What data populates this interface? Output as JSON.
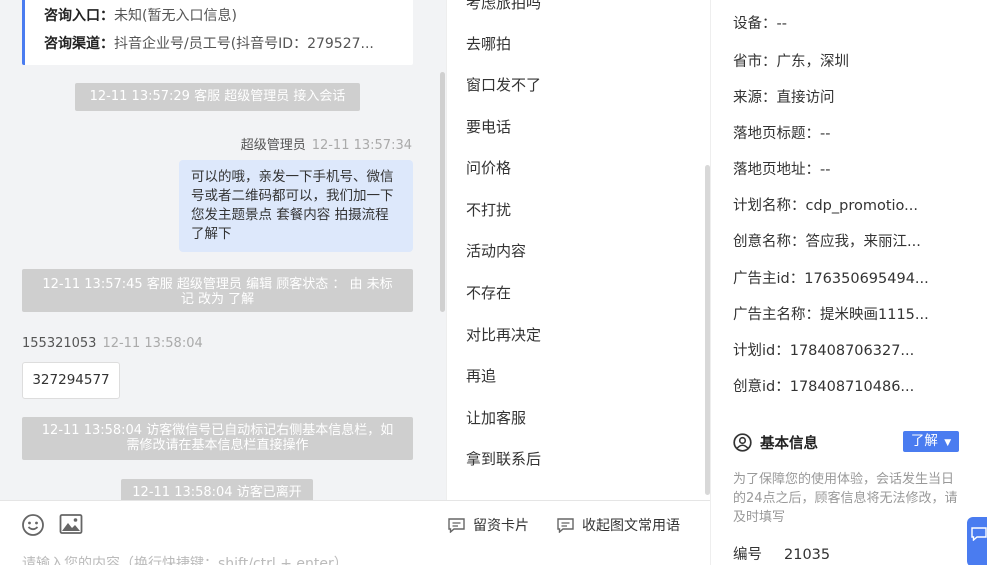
{
  "chat": {
    "info_card": {
      "entry_label": "咨询入口：",
      "entry_value": "未知(暂无入口信息)",
      "channel_label": "咨询渠道：",
      "channel_value": "抖音企业号/员工号(抖音号ID：279527..."
    },
    "sys_1": "12-11 13:57:29 客服 超级管理员 接入会话",
    "msg_1": {
      "sender": "超级管理员",
      "time": "12-11 13:57:34",
      "text": "可以的哦，亲发一下手机号、微信号或者二维码都可以，我们加一下您发主题景点 套餐内容 拍摄流程了解下"
    },
    "sys_2": "12-11 13:57:45 客服 超级管理员 编辑 顾客状态 ： 由 未标记 改为 了解",
    "msg_2": {
      "sender": "155321053",
      "time": "12-11 13:58:04",
      "text": "327294577"
    },
    "sys_3": "12-11 13:58:04 访客微信号已自动标记右侧基本信息栏，如需修改请在基本信息栏直接操作",
    "sys_4": "12-11 13:58:04 访客已离开"
  },
  "input": {
    "card_label": "留资卡片",
    "phrases_label": "收起图文常用语",
    "placeholder": "请输入您的内容（换行快捷键：shift/ctrl + enter）"
  },
  "quick_replies": {
    "top_partial": "考虑旅拍吗",
    "items": [
      "去哪拍",
      "窗口发不了",
      "要电话",
      "问价格",
      "不打扰",
      "活动内容",
      "不存在",
      "对比再决定",
      "再追",
      "让加客服",
      "拿到联系后"
    ]
  },
  "visitor": {
    "device": "设备：--",
    "region": "省市：广东，深圳",
    "source": "来源：直接访问",
    "landing_title": "落地页标题：--",
    "landing_url": "落地页地址：--",
    "plan_name": "计划名称：cdp_promotio...",
    "creative_name": "创意名称：答应我，来丽江...",
    "advertiser_id": "广告主id：176350695494...",
    "advertiser_name": "广告主名称：提米映画1115...",
    "plan_id": "计划id：178408706327...",
    "creative_id": "创意id：178408710486...",
    "basic_title": "基本信息",
    "status": "了解",
    "notice": "为了保障您的使用体验，会话发生当日的24点之后，顾客信息将无法修改，请及时填写",
    "code_label": "编号",
    "code_value": "21035"
  },
  "colors": {
    "accent": "#4a7cf0",
    "bubble": "#dde8fb",
    "system": "#cfcfcf",
    "chat_bg": "#f2f3f5"
  }
}
